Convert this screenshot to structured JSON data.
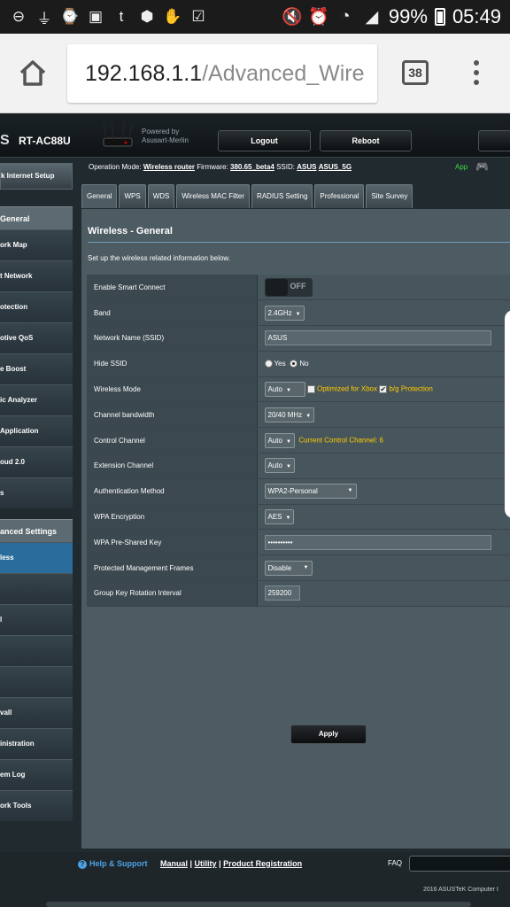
{
  "status_bar": {
    "battery": "99%",
    "time": "05:49"
  },
  "browser": {
    "url_host": "192.168.1.1",
    "url_path": "/Advanced_Wire",
    "tab_count": "38"
  },
  "header": {
    "brand": "S",
    "model": "RT-AC88U",
    "powered_by": "Powered by",
    "firmware_name": "Asuswrt-Merlin",
    "logout": "Logout",
    "reboot": "Reboot"
  },
  "info_bar": {
    "op_mode_label": "Operation Mode:",
    "op_mode": "Wireless router",
    "firmware_label": "Firmware:",
    "firmware": "380.65_beta4",
    "ssid_label": "SSID:",
    "ssid_1": "ASUS",
    "ssid_2": "ASUS_5G",
    "app": "App"
  },
  "sidebar": {
    "quick_setup": "k Internet Setup",
    "general_header": "General",
    "general_items": [
      "ork Map",
      "t Network",
      "otection",
      "otive QoS",
      "e Boost",
      "ic Analyzer",
      "Application",
      "oud 2.0",
      "s"
    ],
    "advanced_header": "anced Settings",
    "advanced_items": [
      "less",
      "",
      "l",
      "",
      "",
      "vall",
      "inistration",
      "em Log",
      "ork Tools"
    ]
  },
  "tabs": [
    "General",
    "WPS",
    "WDS",
    "Wireless MAC Filter",
    "RADIUS Setting",
    "Professional",
    "Site Survey"
  ],
  "section": {
    "title": "Wireless - General",
    "description": "Set up the wireless related information below."
  },
  "form": {
    "smart_connect_label": "Enable Smart Connect",
    "smart_connect_state": "OFF",
    "band_label": "Band",
    "band_value": "2.4GHz",
    "ssid_label": "Network Name (SSID)",
    "ssid_value": "ASUS",
    "hide_ssid_label": "Hide SSID",
    "hide_ssid_yes": "Yes",
    "hide_ssid_no": "No",
    "wireless_mode_label": "Wireless Mode",
    "wireless_mode_value": "Auto",
    "optimized_xbox": "Optimized for Xbox",
    "bg_protection": "b/g Protection",
    "bandwidth_label": "Channel bandwidth",
    "bandwidth_value": "20/40 MHz",
    "control_channel_label": "Control Channel",
    "control_channel_value": "Auto",
    "current_channel": "Current Control Channel: 6",
    "extension_channel_label": "Extension Channel",
    "extension_channel_value": "Auto",
    "auth_label": "Authentication Method",
    "auth_value": "WPA2-Personal",
    "wpa_enc_label": "WPA Encryption",
    "wpa_enc_value": "AES",
    "psk_label": "WPA Pre-Shared Key",
    "psk_value": "••••••••••",
    "pmf_label": "Protected Management Frames",
    "pmf_value": "Disable",
    "group_key_label": "Group Key Rotation Interval",
    "group_key_value": "259200",
    "apply": "Apply"
  },
  "footer": {
    "help": "Help & Support",
    "manual": "Manual",
    "utility": "Utility",
    "product_registration": "Product Registration",
    "faq": "FAQ",
    "copyright": "2016 ASUSTeK Computer I"
  }
}
